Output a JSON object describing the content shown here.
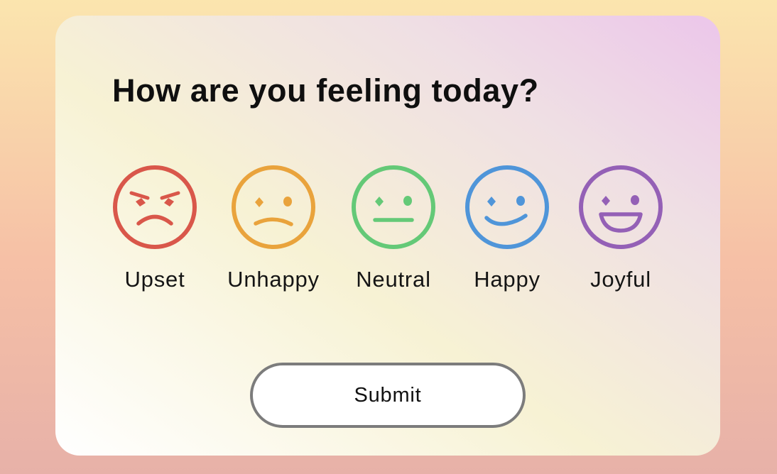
{
  "page": {
    "question": "How are you feeling today?",
    "submit_label": "Submit"
  },
  "moods": [
    {
      "id": "upset",
      "label": "Upset",
      "icon": "angry-face-icon",
      "color": "#d9574a"
    },
    {
      "id": "unhappy",
      "label": "Unhappy",
      "icon": "sad-face-icon",
      "color": "#e9a33c"
    },
    {
      "id": "neutral",
      "label": "Neutral",
      "icon": "neutral-face-icon",
      "color": "#64c977"
    },
    {
      "id": "happy",
      "label": "Happy",
      "icon": "smiling-face-icon",
      "color": "#4f95d9"
    },
    {
      "id": "joyful",
      "label": "Joyful",
      "icon": "grinning-face-icon",
      "color": "#9460b6"
    }
  ],
  "colors": {
    "background_top": "#fbe5ae",
    "background_bottom": "#e7b1a8",
    "card_accent": "#ecc6ea",
    "submit_border": "#7c7c7c"
  }
}
